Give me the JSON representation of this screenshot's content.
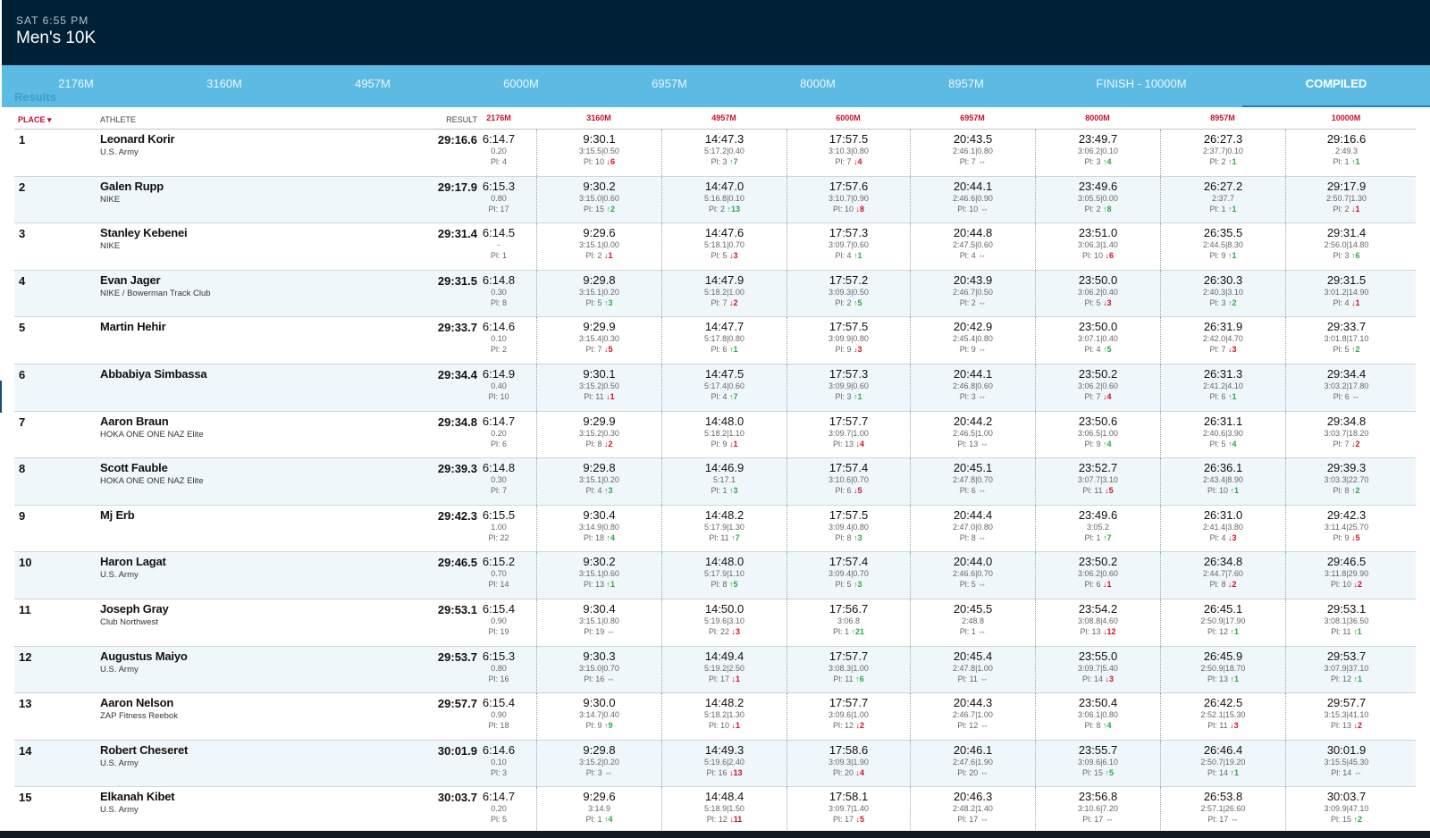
{
  "header": {
    "time": "SAT 6:55 PM",
    "title": "Men's 10K"
  },
  "tabs": [
    {
      "label": "2176M"
    },
    {
      "label": "3160M"
    },
    {
      "label": "4957M"
    },
    {
      "label": "6000M"
    },
    {
      "label": "6957M"
    },
    {
      "label": "8000M"
    },
    {
      "label": "8957M"
    },
    {
      "label": "FINISH - 10000M"
    },
    {
      "label": "COMPILED",
      "active": true
    }
  ],
  "results_label": "Results",
  "columns": {
    "place": "PLACE ▾",
    "athlete": "ATHLETE",
    "result": "RESULT",
    "splits": [
      "2176M",
      "3160M",
      "4957M",
      "6000M",
      "6957M",
      "8000M",
      "8957M",
      "10000M"
    ]
  },
  "rows": [
    {
      "place": "1",
      "name": "Leonard Korir",
      "club": "U.S. Army",
      "result": "29:16.6",
      "splits": [
        {
          "t": "6:14.7",
          "g": "0.20",
          "p": "Pl: 4",
          "m": ""
        },
        {
          "t": "9:30.1",
          "g": "3:15.5|0.50",
          "p": "Pl: 10",
          "m": "↓6",
          "d": "dn"
        },
        {
          "t": "14:47.3",
          "g": "5:17.2|0.40",
          "p": "Pl: 3",
          "m": "↑7",
          "d": "up"
        },
        {
          "t": "17:57.5",
          "g": "3:10.3|0.80",
          "p": "Pl: 7",
          "m": "↓4",
          "d": "dn"
        },
        {
          "t": "20:43.5",
          "g": "2:46.1|0.80",
          "p": "Pl: 7",
          "m": "⇔",
          "d": "eq"
        },
        {
          "t": "23:49.7",
          "g": "3:06.2|0.10",
          "p": "Pl: 3",
          "m": "↑4",
          "d": "up"
        },
        {
          "t": "26:27.3",
          "g": "2:37.7|0.10",
          "p": "Pl: 2",
          "m": "↑1",
          "d": "up"
        },
        {
          "t": "29:16.6",
          "g": "2:49.3",
          "p": "Pl: 1",
          "m": "↑1",
          "d": "up"
        }
      ]
    },
    {
      "place": "2",
      "name": "Galen Rupp",
      "club": "NIKE",
      "result": "29:17.9",
      "splits": [
        {
          "t": "6:15.3",
          "g": "0.80",
          "p": "Pl: 17",
          "m": ""
        },
        {
          "t": "9:30.2",
          "g": "3:15.0|0.60",
          "p": "Pl: 15",
          "m": "↑2",
          "d": "up"
        },
        {
          "t": "14:47.0",
          "g": "5:16.8|0.10",
          "p": "Pl: 2",
          "m": "↑13",
          "d": "up"
        },
        {
          "t": "17:57.6",
          "g": "3:10.7|0.90",
          "p": "Pl: 10",
          "m": "↓8",
          "d": "dn"
        },
        {
          "t": "20:44.1",
          "g": "2:46.6|0.90",
          "p": "Pl: 10",
          "m": "⇔",
          "d": "eq"
        },
        {
          "t": "23:49.6",
          "g": "3:05.5|0.00",
          "p": "Pl: 2",
          "m": "↑8",
          "d": "up"
        },
        {
          "t": "26:27.2",
          "g": "2:37.7",
          "p": "Pl: 1",
          "m": "↑1",
          "d": "up"
        },
        {
          "t": "29:17.9",
          "g": "2:50.7|1.30",
          "p": "Pl: 2",
          "m": "↓1",
          "d": "dn"
        }
      ]
    },
    {
      "place": "3",
      "name": "Stanley Kebenei",
      "club": "NIKE",
      "result": "29:31.4",
      "splits": [
        {
          "t": "6:14.5",
          "g": "-",
          "p": "Pl: 1",
          "m": ""
        },
        {
          "t": "9:29.6",
          "g": "3:15.1|0.00",
          "p": "Pl: 2",
          "m": "↓1",
          "d": "dn"
        },
        {
          "t": "14:47.6",
          "g": "5:18.1|0.70",
          "p": "Pl: 5",
          "m": "↓3",
          "d": "dn"
        },
        {
          "t": "17:57.3",
          "g": "3:09.7|0.60",
          "p": "Pl: 4",
          "m": "↑1",
          "d": "up"
        },
        {
          "t": "20:44.8",
          "g": "2:47.5|0.60",
          "p": "Pl: 4",
          "m": "⇔",
          "d": "eq"
        },
        {
          "t": "23:51.0",
          "g": "3:06.3|1.40",
          "p": "Pl: 10",
          "m": "↓6",
          "d": "dn"
        },
        {
          "t": "26:35.5",
          "g": "2:44.5|8.30",
          "p": "Pl: 9",
          "m": "↑1",
          "d": "up"
        },
        {
          "t": "29:31.4",
          "g": "2:56.0|14.80",
          "p": "Pl: 3",
          "m": "↑6",
          "d": "up"
        }
      ]
    },
    {
      "place": "4",
      "name": "Evan Jager",
      "club": "NIKE / Bowerman Track Club",
      "result": "29:31.5",
      "splits": [
        {
          "t": "6:14.8",
          "g": "0.30",
          "p": "Pl: 8",
          "m": ""
        },
        {
          "t": "9:29.8",
          "g": "3:15.1|0.20",
          "p": "Pl: 5",
          "m": "↑3",
          "d": "up"
        },
        {
          "t": "14:47.9",
          "g": "5:18.2|1.00",
          "p": "Pl: 7",
          "m": "↓2",
          "d": "dn"
        },
        {
          "t": "17:57.2",
          "g": "3:09.3|0.50",
          "p": "Pl: 2",
          "m": "↑5",
          "d": "up"
        },
        {
          "t": "20:43.9",
          "g": "2:46.7|0.50",
          "p": "Pl: 2",
          "m": "⇔",
          "d": "eq"
        },
        {
          "t": "23:50.0",
          "g": "3:06.2|0.40",
          "p": "Pl: 5",
          "m": "↓3",
          "d": "dn"
        },
        {
          "t": "26:30.3",
          "g": "2:40.3|3.10",
          "p": "Pl: 3",
          "m": "↑2",
          "d": "up"
        },
        {
          "t": "29:31.5",
          "g": "3:01.2|14.90",
          "p": "Pl: 4",
          "m": "↓1",
          "d": "dn"
        }
      ]
    },
    {
      "place": "5",
      "name": "Martin Hehir",
      "club": "",
      "result": "29:33.7",
      "splits": [
        {
          "t": "6:14.6",
          "g": "0.10",
          "p": "Pl: 2",
          "m": ""
        },
        {
          "t": "9:29.9",
          "g": "3:15.4|0.30",
          "p": "Pl: 7",
          "m": "↓5",
          "d": "dn"
        },
        {
          "t": "14:47.7",
          "g": "5:17.8|0.80",
          "p": "Pl: 6",
          "m": "↑1",
          "d": "up"
        },
        {
          "t": "17:57.5",
          "g": "3:09.9|0.80",
          "p": "Pl: 9",
          "m": "↓3",
          "d": "dn"
        },
        {
          "t": "20:42.9",
          "g": "2:45.4|0.80",
          "p": "Pl: 9",
          "m": "⇔",
          "d": "eq"
        },
        {
          "t": "23:50.0",
          "g": "3:07.1|0.40",
          "p": "Pl: 4",
          "m": "↑5",
          "d": "up"
        },
        {
          "t": "26:31.9",
          "g": "2:42.0|4.70",
          "p": "Pl: 7",
          "m": "↓3",
          "d": "dn"
        },
        {
          "t": "29:33.7",
          "g": "3:01.8|17.10",
          "p": "Pl: 5",
          "m": "↑2",
          "d": "up"
        }
      ]
    },
    {
      "place": "6",
      "name": "Abbabiya Simbassa",
      "club": "",
      "result": "29:34.4",
      "splits": [
        {
          "t": "6:14.9",
          "g": "0.40",
          "p": "Pl: 10",
          "m": ""
        },
        {
          "t": "9:30.1",
          "g": "3:15.2|0.50",
          "p": "Pl: 11",
          "m": "↓1",
          "d": "dn"
        },
        {
          "t": "14:47.5",
          "g": "5:17.4|0.60",
          "p": "Pl: 4",
          "m": "↑7",
          "d": "up"
        },
        {
          "t": "17:57.3",
          "g": "3:09.9|0.60",
          "p": "Pl: 3",
          "m": "↑1",
          "d": "up"
        },
        {
          "t": "20:44.1",
          "g": "2:46.8|0.60",
          "p": "Pl: 3",
          "m": "⇔",
          "d": "eq"
        },
        {
          "t": "23:50.2",
          "g": "3:06.2|0.60",
          "p": "Pl: 7",
          "m": "↓4",
          "d": "dn"
        },
        {
          "t": "26:31.3",
          "g": "2:41.2|4.10",
          "p": "Pl: 6",
          "m": "↑1",
          "d": "up"
        },
        {
          "t": "29:34.4",
          "g": "3:03.2|17.80",
          "p": "Pl: 6",
          "m": "⇔",
          "d": "eq"
        }
      ]
    },
    {
      "place": "7",
      "name": "Aaron Braun",
      "club": "HOKA ONE ONE NAZ Elite",
      "result": "29:34.8",
      "splits": [
        {
          "t": "6:14.7",
          "g": "0.20",
          "p": "Pl: 6",
          "m": ""
        },
        {
          "t": "9:29.9",
          "g": "3:15.2|0.30",
          "p": "Pl: 8",
          "m": "↓2",
          "d": "dn"
        },
        {
          "t": "14:48.0",
          "g": "5:18.2|1.10",
          "p": "Pl: 9",
          "m": "↓1",
          "d": "dn"
        },
        {
          "t": "17:57.7",
          "g": "3:09.7|1.00",
          "p": "Pl: 13",
          "m": "↓4",
          "d": "dn"
        },
        {
          "t": "20:44.2",
          "g": "2:46.5|1.00",
          "p": "Pl: 13",
          "m": "⇔",
          "d": "eq"
        },
        {
          "t": "23:50.6",
          "g": "3:06.5|1.00",
          "p": "Pl: 9",
          "m": "↑4",
          "d": "up"
        },
        {
          "t": "26:31.1",
          "g": "2:40.6|3.90",
          "p": "Pl: 5",
          "m": "↑4",
          "d": "up"
        },
        {
          "t": "29:34.8",
          "g": "3:03.7|18.20",
          "p": "Pl: 7",
          "m": "↓2",
          "d": "dn"
        }
      ]
    },
    {
      "place": "8",
      "name": "Scott Fauble",
      "club": "HOKA ONE ONE NAZ Elite",
      "result": "29:39.3",
      "splits": [
        {
          "t": "6:14.8",
          "g": "0.30",
          "p": "Pl: 7",
          "m": ""
        },
        {
          "t": "9:29.8",
          "g": "3:15.1|0.20",
          "p": "Pl: 4",
          "m": "↑3",
          "d": "up"
        },
        {
          "t": "14:46.9",
          "g": "5:17.1",
          "p": "Pl: 1",
          "m": "↑3",
          "d": "up"
        },
        {
          "t": "17:57.4",
          "g": "3:10.6|0.70",
          "p": "Pl: 6",
          "m": "↓5",
          "d": "dn"
        },
        {
          "t": "20:45.1",
          "g": "2:47.8|0.70",
          "p": "Pl: 6",
          "m": "⇔",
          "d": "eq"
        },
        {
          "t": "23:52.7",
          "g": "3:07.7|3.10",
          "p": "Pl: 11",
          "m": "↓5",
          "d": "dn"
        },
        {
          "t": "26:36.1",
          "g": "2:43.4|8.90",
          "p": "Pl: 10",
          "m": "↑1",
          "d": "up"
        },
        {
          "t": "29:39.3",
          "g": "3:03.3|22.70",
          "p": "Pl: 8",
          "m": "↑2",
          "d": "up"
        }
      ]
    },
    {
      "place": "9",
      "name": "Mj Erb",
      "club": "",
      "result": "29:42.3",
      "splits": [
        {
          "t": "6:15.5",
          "g": "1.00",
          "p": "Pl: 22",
          "m": ""
        },
        {
          "t": "9:30.4",
          "g": "3:14.9|0.80",
          "p": "Pl: 18",
          "m": "↑4",
          "d": "up"
        },
        {
          "t": "14:48.2",
          "g": "5:17.9|1.30",
          "p": "Pl: 11",
          "m": "↑7",
          "d": "up"
        },
        {
          "t": "17:57.5",
          "g": "3:09.4|0.80",
          "p": "Pl: 8",
          "m": "↑3",
          "d": "up"
        },
        {
          "t": "20:44.4",
          "g": "2:47.0|0.80",
          "p": "Pl: 8",
          "m": "⇔",
          "d": "eq"
        },
        {
          "t": "23:49.6",
          "g": "3:05.2",
          "p": "Pl: 1",
          "m": "↑7",
          "d": "up"
        },
        {
          "t": "26:31.0",
          "g": "2:41.4|3.80",
          "p": "Pl: 4",
          "m": "↓3",
          "d": "dn"
        },
        {
          "t": "29:42.3",
          "g": "3:11.4|25.70",
          "p": "Pl: 9",
          "m": "↓5",
          "d": "dn"
        }
      ]
    },
    {
      "place": "10",
      "name": "Haron Lagat",
      "club": "U.S. Army",
      "result": "29:46.5",
      "splits": [
        {
          "t": "6:15.2",
          "g": "0.70",
          "p": "Pl: 14",
          "m": ""
        },
        {
          "t": "9:30.2",
          "g": "3:15.1|0.60",
          "p": "Pl: 13",
          "m": "↑1",
          "d": "up"
        },
        {
          "t": "14:48.0",
          "g": "5:17.9|1.10",
          "p": "Pl: 8",
          "m": "↑5",
          "d": "up"
        },
        {
          "t": "17:57.4",
          "g": "3:09.4|0.70",
          "p": "Pl: 5",
          "m": "↑3",
          "d": "up"
        },
        {
          "t": "20:44.0",
          "g": "2:46.6|0.70",
          "p": "Pl: 5",
          "m": "⇔",
          "d": "eq"
        },
        {
          "t": "23:50.2",
          "g": "3:06.2|0.60",
          "p": "Pl: 6",
          "m": "↓1",
          "d": "dn"
        },
        {
          "t": "26:34.8",
          "g": "2:44.7|7.60",
          "p": "Pl: 8",
          "m": "↓2",
          "d": "dn"
        },
        {
          "t": "29:46.5",
          "g": "3:11.8|29.90",
          "p": "Pl: 10",
          "m": "↓2",
          "d": "dn"
        }
      ]
    },
    {
      "place": "11",
      "name": "Joseph Gray",
      "club": "Club Northwest",
      "result": "29:53.1",
      "splits": [
        {
          "t": "6:15.4",
          "g": "0.90",
          "p": "Pl: 19",
          "m": ""
        },
        {
          "t": "9:30.4",
          "g": "3:15.1|0.80",
          "p": "Pl: 19",
          "m": "⇔",
          "d": "eq"
        },
        {
          "t": "14:50.0",
          "g": "5:19.6|3.10",
          "p": "Pl: 22",
          "m": "↓3",
          "d": "dn"
        },
        {
          "t": "17:56.7",
          "g": "3:06.8",
          "p": "Pl: 1",
          "m": "↑21",
          "d": "up"
        },
        {
          "t": "20:45.5",
          "g": "2:48.8",
          "p": "Pl: 1",
          "m": "⇔",
          "d": "eq"
        },
        {
          "t": "23:54.2",
          "g": "3:08.8|4.60",
          "p": "Pl: 13",
          "m": "↓12",
          "d": "dn"
        },
        {
          "t": "26:45.1",
          "g": "2:50.9|17.90",
          "p": "Pl: 12",
          "m": "↑1",
          "d": "up"
        },
        {
          "t": "29:53.1",
          "g": "3:08.1|36.50",
          "p": "Pl: 11",
          "m": "↑1",
          "d": "up"
        }
      ]
    },
    {
      "place": "12",
      "name": "Augustus Maiyo",
      "club": "U.S. Army",
      "result": "29:53.7",
      "splits": [
        {
          "t": "6:15.3",
          "g": "0.80",
          "p": "Pl: 16",
          "m": ""
        },
        {
          "t": "9:30.3",
          "g": "3:15.0|0.70",
          "p": "Pl: 16",
          "m": "⇔",
          "d": "eq"
        },
        {
          "t": "14:49.4",
          "g": "5:19.2|2.50",
          "p": "Pl: 17",
          "m": "↓1",
          "d": "dn"
        },
        {
          "t": "17:57.7",
          "g": "3:08.3|1.00",
          "p": "Pl: 11",
          "m": "↑6",
          "d": "up"
        },
        {
          "t": "20:45.4",
          "g": "2:47.8|1.00",
          "p": "Pl: 11",
          "m": "⇔",
          "d": "eq"
        },
        {
          "t": "23:55.0",
          "g": "3:09.7|5.40",
          "p": "Pl: 14",
          "m": "↓3",
          "d": "dn"
        },
        {
          "t": "26:45.9",
          "g": "2:50.9|18.70",
          "p": "Pl: 13",
          "m": "↑1",
          "d": "up"
        },
        {
          "t": "29:53.7",
          "g": "3:07.9|37.10",
          "p": "Pl: 12",
          "m": "↑1",
          "d": "up"
        }
      ]
    },
    {
      "place": "13",
      "name": "Aaron Nelson",
      "club": "ZAP Fitness Reebok",
      "result": "29:57.7",
      "splits": [
        {
          "t": "6:15.4",
          "g": "0.90",
          "p": "Pl: 18",
          "m": ""
        },
        {
          "t": "9:30.0",
          "g": "3:14.7|0.40",
          "p": "Pl: 9",
          "m": "↑9",
          "d": "up"
        },
        {
          "t": "14:48.2",
          "g": "5:18.2|1.30",
          "p": "Pl: 10",
          "m": "↓1",
          "d": "dn"
        },
        {
          "t": "17:57.7",
          "g": "3:09.6|1.00",
          "p": "Pl: 12",
          "m": "↓2",
          "d": "dn"
        },
        {
          "t": "20:44.3",
          "g": "2:46.7|1.00",
          "p": "Pl: 12",
          "m": "⇔",
          "d": "eq"
        },
        {
          "t": "23:50.4",
          "g": "3:06.1|0.80",
          "p": "Pl: 8",
          "m": "↑4",
          "d": "up"
        },
        {
          "t": "26:42.5",
          "g": "2:52.1|15.30",
          "p": "Pl: 11",
          "m": "↓3",
          "d": "dn"
        },
        {
          "t": "29:57.7",
          "g": "3:15.3|41.10",
          "p": "Pl: 13",
          "m": "↓2",
          "d": "dn"
        }
      ]
    },
    {
      "place": "14",
      "name": "Robert Cheseret",
      "club": "U.S. Army",
      "result": "30:01.9",
      "splits": [
        {
          "t": "6:14.6",
          "g": "0.10",
          "p": "Pl: 3",
          "m": ""
        },
        {
          "t": "9:29.8",
          "g": "3:15.2|0.20",
          "p": "Pl: 3",
          "m": "⇔",
          "d": "eq"
        },
        {
          "t": "14:49.3",
          "g": "5:19.6|2.40",
          "p": "Pl: 16",
          "m": "↓13",
          "d": "dn"
        },
        {
          "t": "17:58.6",
          "g": "3:09.3|1.90",
          "p": "Pl: 20",
          "m": "↓4",
          "d": "dn"
        },
        {
          "t": "20:46.1",
          "g": "2:47.6|1.90",
          "p": "Pl: 20",
          "m": "⇔",
          "d": "eq"
        },
        {
          "t": "23:55.7",
          "g": "3:09.6|6.10",
          "p": "Pl: 15",
          "m": "↑5",
          "d": "up"
        },
        {
          "t": "26:46.4",
          "g": "2:50.7|19.20",
          "p": "Pl: 14",
          "m": "↑1",
          "d": "up"
        },
        {
          "t": "30:01.9",
          "g": "3:15.5|45.30",
          "p": "Pl: 14",
          "m": "⇔",
          "d": "eq"
        }
      ]
    },
    {
      "place": "15",
      "name": "Elkanah Kibet",
      "club": "U.S. Army",
      "result": "30:03.7",
      "splits": [
        {
          "t": "6:14.7",
          "g": "0.20",
          "p": "Pl: 5",
          "m": ""
        },
        {
          "t": "9:29.6",
          "g": "3:14.9",
          "p": "Pl: 1",
          "m": "↑4",
          "d": "up"
        },
        {
          "t": "14:48.4",
          "g": "5:18.9|1.50",
          "p": "Pl: 12",
          "m": "↓11",
          "d": "dn"
        },
        {
          "t": "17:58.1",
          "g": "3:09.7|1.40",
          "p": "Pl: 17",
          "m": "↓5",
          "d": "dn"
        },
        {
          "t": "20:46.3",
          "g": "2:48.2|1.40",
          "p": "Pl: 17",
          "m": "⇔",
          "d": "eq"
        },
        {
          "t": "23:56.8",
          "g": "3:10.6|7.20",
          "p": "Pl: 17",
          "m": "⇔",
          "d": "eq"
        },
        {
          "t": "26:53.8",
          "g": "2:57.1|26.60",
          "p": "Pl: 17",
          "m": "⇔",
          "d": "eq"
        },
        {
          "t": "30:03.7",
          "g": "3:09.9|47.10",
          "p": "Pl: 15",
          "m": "↑2",
          "d": "up"
        }
      ]
    }
  ]
}
